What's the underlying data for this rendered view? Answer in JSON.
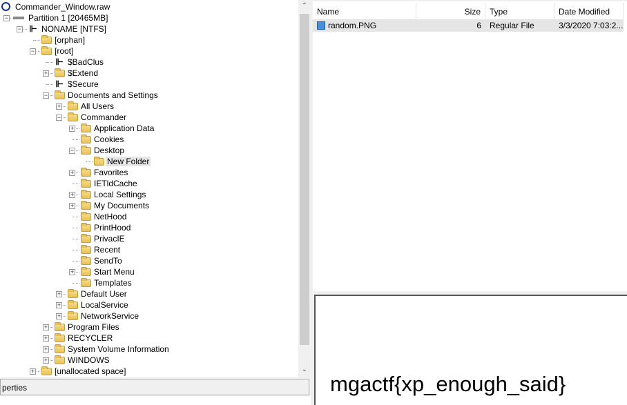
{
  "tree": [
    {
      "label": "Commander_Window.raw",
      "level": 0,
      "exp": "",
      "icon": "disk-image-icon"
    },
    {
      "label": "Partition 1 [20465MB]",
      "level": 1,
      "exp": "-",
      "icon": "drive-icon"
    },
    {
      "label": "NONAME [NTFS]",
      "level": 2,
      "exp": "-",
      "icon": "filesystem-icon"
    },
    {
      "label": "[orphan]",
      "level": 3,
      "exp": "",
      "icon": "folder-icon"
    },
    {
      "label": "[root]",
      "level": 3,
      "exp": "-",
      "icon": "folder-icon"
    },
    {
      "label": "$BadClus",
      "level": 4,
      "exp": "",
      "icon": "filesystem-icon"
    },
    {
      "label": "$Extend",
      "level": 4,
      "exp": "+",
      "icon": "folder-icon"
    },
    {
      "label": "$Secure",
      "level": 4,
      "exp": "",
      "icon": "filesystem-icon"
    },
    {
      "label": "Documents and Settings",
      "level": 4,
      "exp": "-",
      "icon": "folder-icon"
    },
    {
      "label": "All Users",
      "level": 5,
      "exp": "+",
      "icon": "folder-icon"
    },
    {
      "label": "Commander",
      "level": 5,
      "exp": "-",
      "icon": "folder-icon"
    },
    {
      "label": "Application Data",
      "level": 6,
      "exp": "+",
      "icon": "folder-icon"
    },
    {
      "label": "Cookies",
      "level": 6,
      "exp": "",
      "icon": "folder-icon"
    },
    {
      "label": "Desktop",
      "level": 6,
      "exp": "-",
      "icon": "folder-icon"
    },
    {
      "label": "New Folder",
      "level": 7,
      "exp": "",
      "icon": "folder-icon",
      "selected": true
    },
    {
      "label": "Favorites",
      "level": 6,
      "exp": "+",
      "icon": "folder-icon"
    },
    {
      "label": "IETldCache",
      "level": 6,
      "exp": "",
      "icon": "folder-icon"
    },
    {
      "label": "Local Settings",
      "level": 6,
      "exp": "+",
      "icon": "folder-icon"
    },
    {
      "label": "My Documents",
      "level": 6,
      "exp": "+",
      "icon": "folder-icon"
    },
    {
      "label": "NetHood",
      "level": 6,
      "exp": "",
      "icon": "folder-icon"
    },
    {
      "label": "PrintHood",
      "level": 6,
      "exp": "",
      "icon": "folder-icon"
    },
    {
      "label": "PrivacIE",
      "level": 6,
      "exp": "",
      "icon": "folder-icon"
    },
    {
      "label": "Recent",
      "level": 6,
      "exp": "",
      "icon": "folder-icon"
    },
    {
      "label": "SendTo",
      "level": 6,
      "exp": "",
      "icon": "folder-icon"
    },
    {
      "label": "Start Menu",
      "level": 6,
      "exp": "+",
      "icon": "folder-icon"
    },
    {
      "label": "Templates",
      "level": 6,
      "exp": "",
      "icon": "folder-icon"
    },
    {
      "label": "Default User",
      "level": 5,
      "exp": "+",
      "icon": "folder-icon"
    },
    {
      "label": "LocalService",
      "level": 5,
      "exp": "+",
      "icon": "folder-icon"
    },
    {
      "label": "NetworkService",
      "level": 5,
      "exp": "+",
      "icon": "folder-icon"
    },
    {
      "label": "Program Files",
      "level": 4,
      "exp": "+",
      "icon": "folder-icon"
    },
    {
      "label": "RECYCLER",
      "level": 4,
      "exp": "+",
      "icon": "folder-icon"
    },
    {
      "label": "System Volume Information",
      "level": 4,
      "exp": "+",
      "icon": "folder-icon"
    },
    {
      "label": "WINDOWS",
      "level": 4,
      "exp": "+",
      "icon": "folder-icon"
    },
    {
      "label": "[unallocated space]",
      "level": 3,
      "exp": "+",
      "icon": "folder-icon"
    }
  ],
  "properties_label": "perties",
  "list": {
    "headers": {
      "name": "Name",
      "size": "Size",
      "type": "Type",
      "date": "Date Modified"
    },
    "rows": [
      {
        "name": "random.PNG",
        "size": "6",
        "type": "Regular File",
        "date": "3/3/2020 7:03:2...",
        "icon": "png-file-icon"
      }
    ]
  },
  "preview_text": "mgactf{xp_enough_said}"
}
